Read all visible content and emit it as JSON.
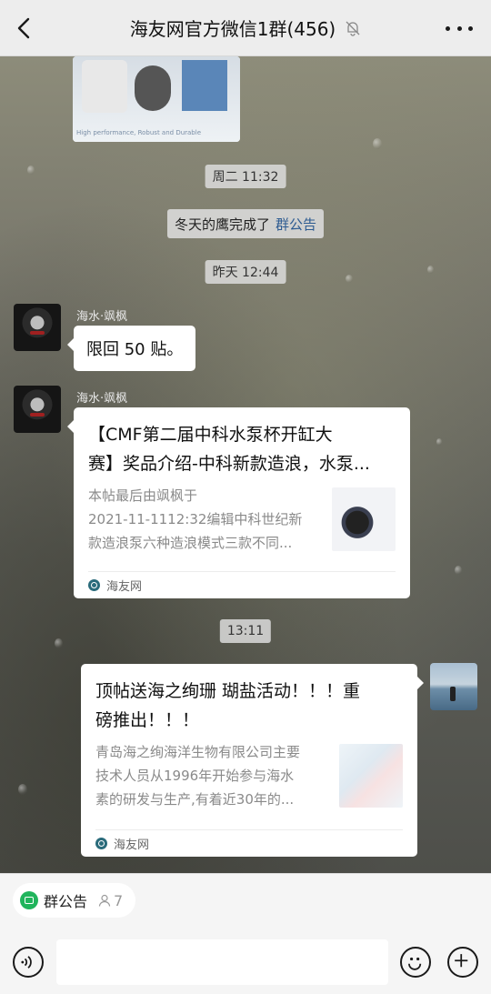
{
  "header": {
    "title": "海友网官方微信1群(456)",
    "back_icon": "chevron-left-icon",
    "mute_icon": "bell-off-icon",
    "more_icon": "more-dots-icon"
  },
  "messages": {
    "image_caption": "High performance, Robust and Durable",
    "time_1": "周二 11:32",
    "system_text": "冬天的鹰完成了",
    "system_link": "群公告",
    "time_2": "昨天 12:44",
    "msg1_sender": "海水·飒枫",
    "msg1_text": "限回 50 贴。",
    "msg2_sender": "海水·飒枫",
    "card1": {
      "title_line1": "【CMF第二届中科水泵杯开缸大",
      "title_line2": "赛】奖品介绍-中科新款造浪，水泵...",
      "desc_line1": "本帖最后由飒枫于",
      "desc_line2": "2021-11-1112:32编辑中科世纪新",
      "desc_line3": "款造浪泵六种造浪模式三款不同...",
      "source": "海友网"
    },
    "time_3": "13:11",
    "card2": {
      "title_line1": "顶帖送海之绚珊 瑚盐活动！！！重",
      "title_line2": "磅推出！！！",
      "desc_line1": "青岛海之绚海洋生物有限公司主要",
      "desc_line2": "技术人员从1996年开始参与海水",
      "desc_line3": "素的研发与生产,有着近30年的...",
      "source": "海友网"
    }
  },
  "bottom": {
    "notice_label": "群公告",
    "notice_count": "7"
  }
}
